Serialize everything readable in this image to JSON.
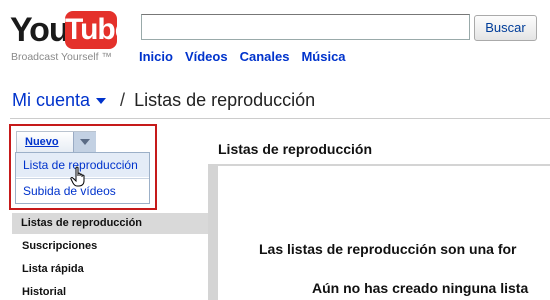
{
  "logo": {
    "you": "You",
    "tube": "Tube",
    "tagline": "Broadcast Yourself ™"
  },
  "search": {
    "value": "",
    "button_label": "Buscar"
  },
  "topnav": [
    "Inicio",
    "Vídeos",
    "Canales",
    "Música"
  ],
  "header": {
    "account": "Mi cuenta",
    "separator": "/",
    "title": "Listas de reproducción"
  },
  "nuevo": {
    "label": "Nuevo",
    "menu": [
      "Lista de reproducción",
      "Subida de vídeos"
    ]
  },
  "main": {
    "title": "Listas de reproducción",
    "line1": "Las listas de reproducción son una for",
    "line2": "Aún no has creado ninguna lista"
  },
  "sidebar": {
    "items": [
      "Listas de reproducción",
      "Suscripciones",
      "Lista rápida",
      "Historial"
    ]
  },
  "colors": {
    "link": "#0033cc",
    "highlight_frame": "#c61a1a",
    "youtube_red": "#e4312b"
  },
  "icons": {
    "dropdown": "chevron-down-icon",
    "cursor": "hand-pointer-icon"
  }
}
